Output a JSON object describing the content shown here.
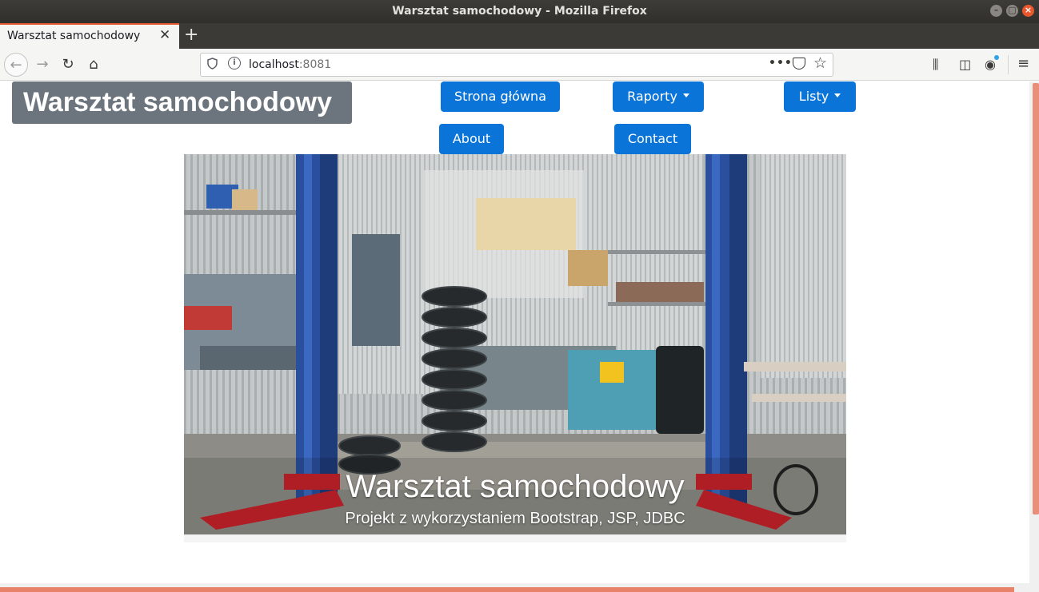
{
  "window": {
    "title": "Warsztat samochodowy - Mozilla Firefox",
    "controls": {
      "minimize": "–",
      "maximize": "▢",
      "close": "×"
    }
  },
  "tabs": [
    {
      "label": "Warsztat samochodowy",
      "close": "✕",
      "active": true
    }
  ],
  "new_tab_glyph": "+",
  "toolbar": {
    "back_glyph": "←",
    "forward_glyph": "→",
    "reload_glyph": "↻",
    "home_glyph": "⌂",
    "url_host": "localhost",
    "url_port": ":8081",
    "more_glyph": "•••",
    "star_glyph": "☆",
    "library_glyph": "⫼",
    "sidebar_glyph": "◫",
    "account_glyph": "◉",
    "menu_glyph": "≡",
    "icons": [
      "back-icon",
      "forward-icon",
      "reload-icon",
      "home-icon",
      "shield-icon",
      "info-icon",
      "more-icon",
      "pocket-icon",
      "star-icon",
      "library-icon",
      "sidebar-icon",
      "account-icon",
      "menu-icon"
    ]
  },
  "page": {
    "brand": "Warsztat samochodowy",
    "nav": {
      "home": "Strona główna",
      "reports": "Raporty",
      "lists": "Listy",
      "about": "About",
      "contact": "Contact"
    },
    "hero": {
      "title": "Warsztat samochodowy",
      "subtitle": "Projekt z wykorzystaniem Bootstrap, JSP, JDBC"
    }
  },
  "colors": {
    "primary_button": "#0a74d9",
    "brand_bg": "#6c757d",
    "accent": "#e9572d",
    "lift_blue": "#2a4f9e",
    "lift_red": "#c8232a"
  }
}
